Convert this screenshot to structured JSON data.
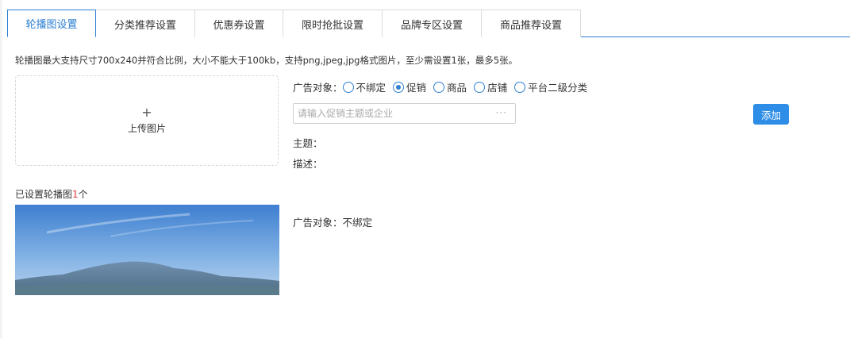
{
  "tabs": [
    {
      "label": "轮播图设置",
      "active": true
    },
    {
      "label": "分类推荐设置",
      "active": false
    },
    {
      "label": "优惠券设置",
      "active": false
    },
    {
      "label": "限时抢批设置",
      "active": false
    },
    {
      "label": "品牌专区设置",
      "active": false
    },
    {
      "label": "商品推荐设置",
      "active": false
    }
  ],
  "notice": "轮播图最大支持尺寸700x240并符合比例，大小不能大于100kb，支持png,jpeg,jpg格式图片，至少需设置1张，最多5张。",
  "upload": {
    "icon": "plus-icon",
    "plus": "+",
    "label": "上传图片"
  },
  "ad_target": {
    "label": "广告对象：",
    "options": [
      {
        "label": "不绑定",
        "checked": false
      },
      {
        "label": "促销",
        "checked": true
      },
      {
        "label": "商品",
        "checked": false
      },
      {
        "label": "店铺",
        "checked": false
      },
      {
        "label": "平台二级分类",
        "checked": false
      }
    ]
  },
  "search": {
    "placeholder": "请输入促销主题或企业",
    "value": "",
    "ellipsis": "···"
  },
  "add_button": "添加",
  "fields": {
    "topic_label": "主题：",
    "desc_label": "描述："
  },
  "set_count": {
    "prefix": "已设置轮播图",
    "count": "1",
    "suffix": "个"
  },
  "banners": [
    {
      "ad_target": "广告对象：不绑定"
    }
  ],
  "colors": {
    "accent": "#2f80d1",
    "button": "#2e8de6",
    "count": "#e03a3a"
  }
}
